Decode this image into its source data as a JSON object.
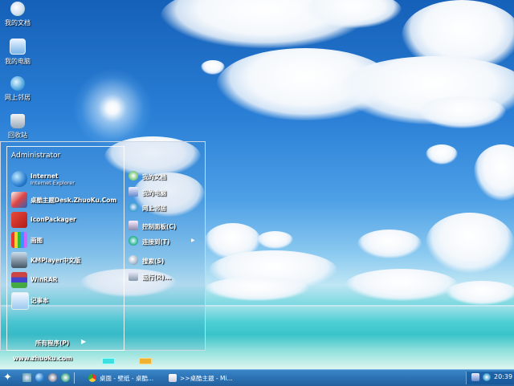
{
  "desktop_icons": [
    {
      "label": "我的文档",
      "icon": "my-documents-icon"
    },
    {
      "label": "我的电脑",
      "icon": "my-computer-icon"
    },
    {
      "label": "网上邻居",
      "icon": "network-places-icon"
    },
    {
      "label": "回收站",
      "icon": "recycle-bin-icon"
    }
  ],
  "start_menu": {
    "username": "Administrator",
    "programs": [
      {
        "title": "Internet",
        "subtitle": "Internet Explorer",
        "icon": "internet-explorer-icon"
      },
      {
        "title": "桌酷主题Desk.ZhuoKu.Com",
        "icon": "zhuoku-theme-icon"
      },
      {
        "title": "IconPackager",
        "icon": "iconpackager-icon"
      },
      {
        "title": "画图",
        "icon": "paint-icon"
      },
      {
        "title": "KMPlayer中文版",
        "icon": "kmplayer-icon"
      },
      {
        "title": "WinRAR",
        "icon": "winrar-icon"
      },
      {
        "title": "记事本",
        "icon": "notepad-icon"
      }
    ],
    "all_programs": "所有程序(P)",
    "right_items": [
      {
        "label": "我的文档",
        "icon": "documents-icon"
      },
      {
        "label": "我的电脑",
        "icon": "computer-icon"
      },
      {
        "label": "网上邻居",
        "icon": "network-icon"
      },
      {
        "label": "控制面板(C)",
        "icon": "control-panel-icon"
      },
      {
        "label": "连接到(T)",
        "icon": "connect-to-icon"
      },
      {
        "label": "搜索(S)",
        "icon": "search-icon"
      },
      {
        "label": "运行(R)...",
        "icon": "run-icon"
      }
    ],
    "website": "www.zhuoku.com"
  },
  "taskbar": {
    "tasks": [
      {
        "label": "桌面 - 壁纸 - 桌酷...",
        "icon": "chrome-icon"
      },
      {
        "label": ">>桌酷主题 - Mi...",
        "icon": "document-icon"
      }
    ],
    "clock": "20:39"
  },
  "colors": {
    "sky_top": "#1560b8",
    "sea": "#3cc7cf",
    "taskbar": "#2d74b6"
  }
}
